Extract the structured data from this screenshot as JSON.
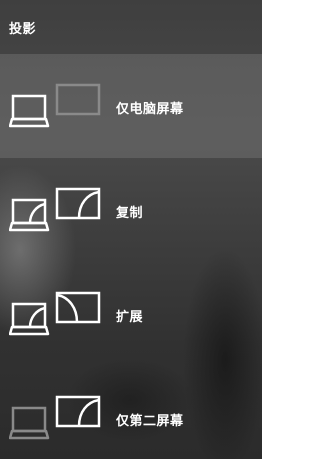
{
  "panel": {
    "title": "投影"
  },
  "options": [
    {
      "label": "仅电脑屏幕",
      "icon": "pc-screen-only-icon",
      "selected": true
    },
    {
      "label": "复制",
      "icon": "duplicate-icon",
      "selected": false
    },
    {
      "label": "扩展",
      "icon": "extend-icon",
      "selected": false
    },
    {
      "label": "仅第二屏幕",
      "icon": "second-screen-only-icon",
      "selected": false
    }
  ],
  "colors": {
    "active_stroke": "#ffffff",
    "inactive_stroke": "#8a8a8a",
    "selected_background": "#6a6a69"
  }
}
